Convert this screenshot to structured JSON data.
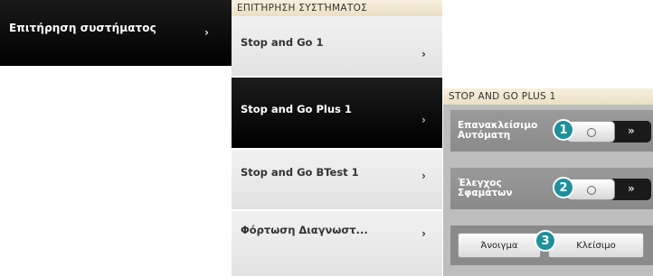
{
  "system_menu": {
    "label": "Επιτήρηση συστήματος",
    "chevron": "›"
  },
  "middle_panel": {
    "title": "ΕΠΙΤΉΡΗΣΗ ΣΥΣΤΉΜΑΤΟΣ",
    "items": [
      {
        "label": "Stop and Go 1",
        "chevron": "›"
      },
      {
        "label": "Stop and Go Plus 1",
        "chevron": "›"
      },
      {
        "label": "Stop and Go BTest 1",
        "chevron": "›"
      },
      {
        "label": "Φόρτωση Διαγνωστ...",
        "chevron": "›"
      }
    ]
  },
  "right_panel": {
    "title": "STOP AND GO PLUS 1",
    "rows": [
      {
        "label": "Επανακλείσιμο Αυτόματη",
        "badge": "1",
        "toggle_arrows": "»"
      },
      {
        "label": "Έλεγχος Σφαμάτων",
        "badge": "2",
        "toggle_arrows": "»"
      }
    ],
    "buttons": {
      "open": "Άνοιγμα",
      "close": "Κλείσιμο",
      "badge": "3"
    }
  },
  "colors": {
    "badge": "#1f8f9a",
    "header_bg": "#ecdfc3",
    "active_item": "#000000"
  }
}
